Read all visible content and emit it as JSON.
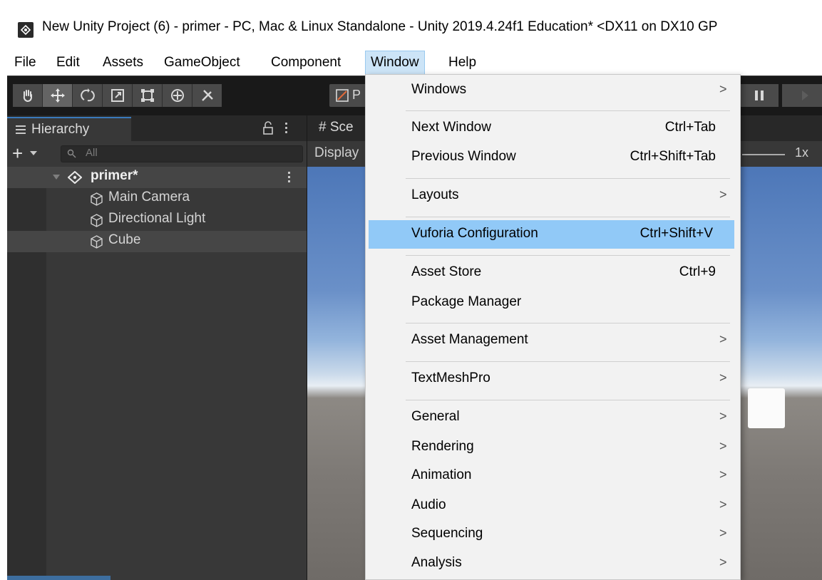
{
  "window": {
    "title": "New Unity Project (6) - primer - PC, Mac & Linux Standalone - Unity 2019.4.24f1 Education* <DX11 on DX10 GP"
  },
  "menubar": {
    "items": [
      "File",
      "Edit",
      "Assets",
      "GameObject",
      "Component",
      "Window",
      "Help"
    ],
    "active": "Window"
  },
  "toolbar": {
    "tools": [
      "hand-tool-icon",
      "move-tool-icon",
      "rotate-tool-icon",
      "scale-tool-icon",
      "rect-tool-icon",
      "transform-tool-icon",
      "custom-tool-icon"
    ],
    "selected_tool": "move-tool-icon",
    "pivot_label": "P"
  },
  "hierarchy": {
    "tab_label": "Hierarchy",
    "search_placeholder": "All",
    "scene_name": "primer*",
    "objects": [
      "Main Camera",
      "Directional Light",
      "Cube"
    ],
    "selected_object": "Cube"
  },
  "scene_view": {
    "tab_label": "# Sce",
    "display_label": "Display",
    "zoom_label": "1x"
  },
  "window_menu": {
    "items": [
      {
        "label": "Windows",
        "submenu": true
      },
      {
        "label": "Next Window",
        "shortcut": "Ctrl+Tab"
      },
      {
        "label": "Previous Window",
        "shortcut": "Ctrl+Shift+Tab"
      },
      {
        "label": "Layouts",
        "submenu": true
      },
      {
        "label": "Vuforia Configuration",
        "shortcut": "Ctrl+Shift+V",
        "highlighted": true
      },
      {
        "label": "Asset Store",
        "shortcut": "Ctrl+9"
      },
      {
        "label": "Package Manager"
      },
      {
        "label": "Asset Management",
        "submenu": true
      },
      {
        "label": "TextMeshPro",
        "submenu": true
      },
      {
        "label": "General",
        "submenu": true
      },
      {
        "label": "Rendering",
        "submenu": true
      },
      {
        "label": "Animation",
        "submenu": true
      },
      {
        "label": "Audio",
        "submenu": true
      },
      {
        "label": "Sequencing",
        "submenu": true
      },
      {
        "label": "Analysis",
        "submenu": true
      }
    ],
    "submenu_arrow": ">"
  },
  "colors": {
    "menu_highlight": "#91c9f7",
    "active_menu": "#cce4f7",
    "editor_dark": "#383838"
  }
}
